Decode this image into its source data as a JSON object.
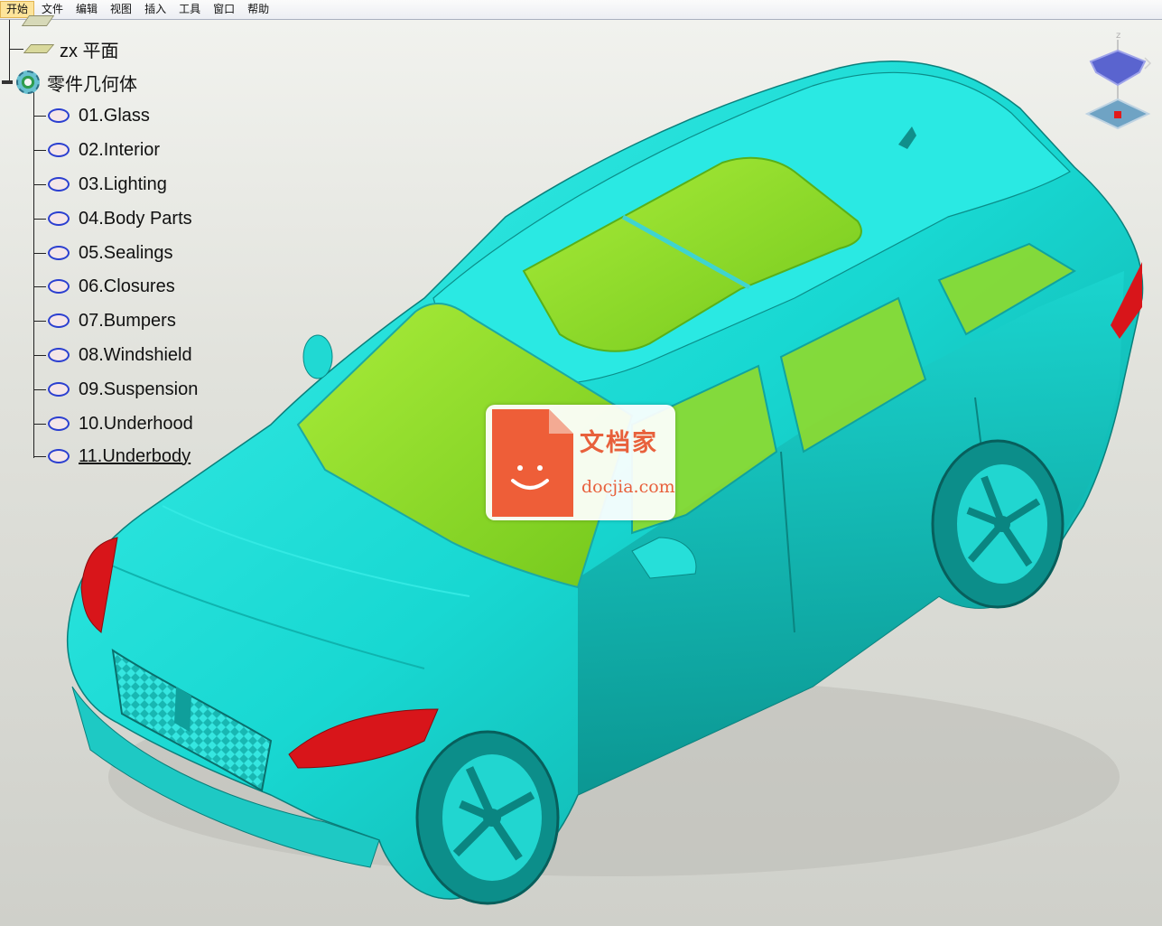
{
  "menubar": {
    "items": [
      "开始",
      "文件",
      "编辑",
      "视图",
      "插入",
      "工具",
      "窗口",
      "帮助"
    ],
    "active_index": 0
  },
  "tree": {
    "zx_plane_label": "zx 平面",
    "part_body_label": "零件几何体",
    "items": [
      {
        "label": "01.Glass"
      },
      {
        "label": "02.Interior"
      },
      {
        "label": "03.Lighting"
      },
      {
        "label": "04.Body Parts"
      },
      {
        "label": "05.Sealings"
      },
      {
        "label": "06.Closures"
      },
      {
        "label": "07.Bumpers"
      },
      {
        "label": "08.Windshield"
      },
      {
        "label": "09.Suspension"
      },
      {
        "label": "10.Underhood"
      },
      {
        "label": "11.Underbody"
      }
    ],
    "selected_index": 10
  },
  "compass": {
    "axis_label": "z"
  },
  "watermark": {
    "text_cn": "文档家",
    "text_en": "docjia.com"
  },
  "colors": {
    "body": "#16d4d0",
    "glass": "#8ee02a",
    "lights": "#d8151a",
    "background": "#dcddd7"
  }
}
